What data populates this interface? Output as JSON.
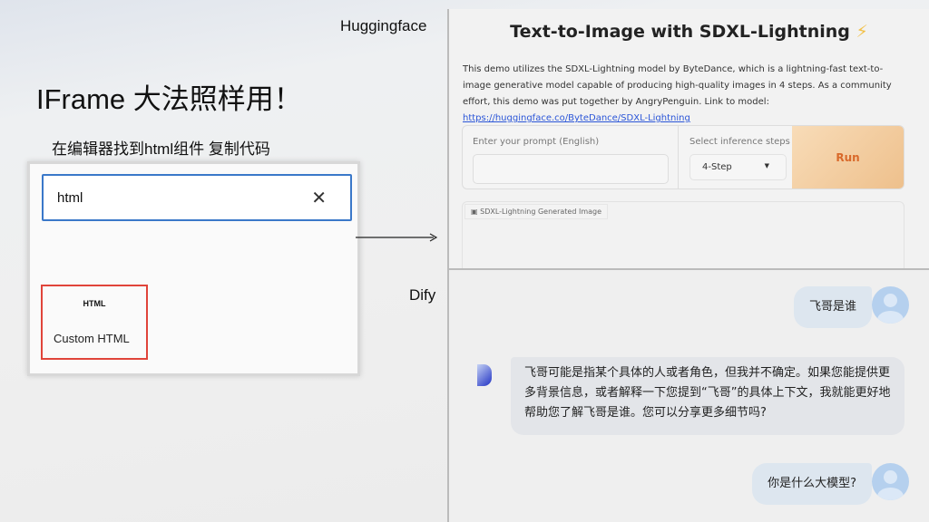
{
  "slide": {
    "title": "IFrame 大法照样用！",
    "subtitle": "在编辑器找到html组件 复制代码",
    "label_huggingface": "Huggingface",
    "label_dify": "Dify"
  },
  "editor": {
    "search_value": "html",
    "clear_icon": "✕",
    "component_icon_text": "HTML",
    "component_label": "Custom HTML"
  },
  "huggingface_app": {
    "title": "Text-to-Image with SDXL-Lightning",
    "title_icon": "⚡",
    "description": "This demo utilizes the SDXL-Lightning model by ByteDance, which is a lightning-fast text-to-image generative model capable of producing high-quality images in 4 steps. As a community effort, this demo was put together by AngryPenguin. Link to model: ",
    "link": "https://huggingface.co/ByteDance/SDXL-Lightning",
    "prompt_label": "Enter your prompt (English)",
    "prompt_value": "",
    "steps_label": "Select inference steps",
    "steps_value": "4-Step",
    "run_label": "Run",
    "output_label": "SDXL-Lightning Generated Image"
  },
  "dify_chat": {
    "messages": [
      {
        "role": "user",
        "text": "飞哥是谁"
      },
      {
        "role": "assistant",
        "text": "飞哥可能是指某个具体的人或者角色，但我并不确定。如果您能提供更多背景信息，或者解释一下您提到“飞哥”的具体上下文，我就能更好地帮助您了解飞哥是谁。您可以分享更多细节吗?"
      },
      {
        "role": "user",
        "text": "你是什么大模型?"
      }
    ]
  }
}
